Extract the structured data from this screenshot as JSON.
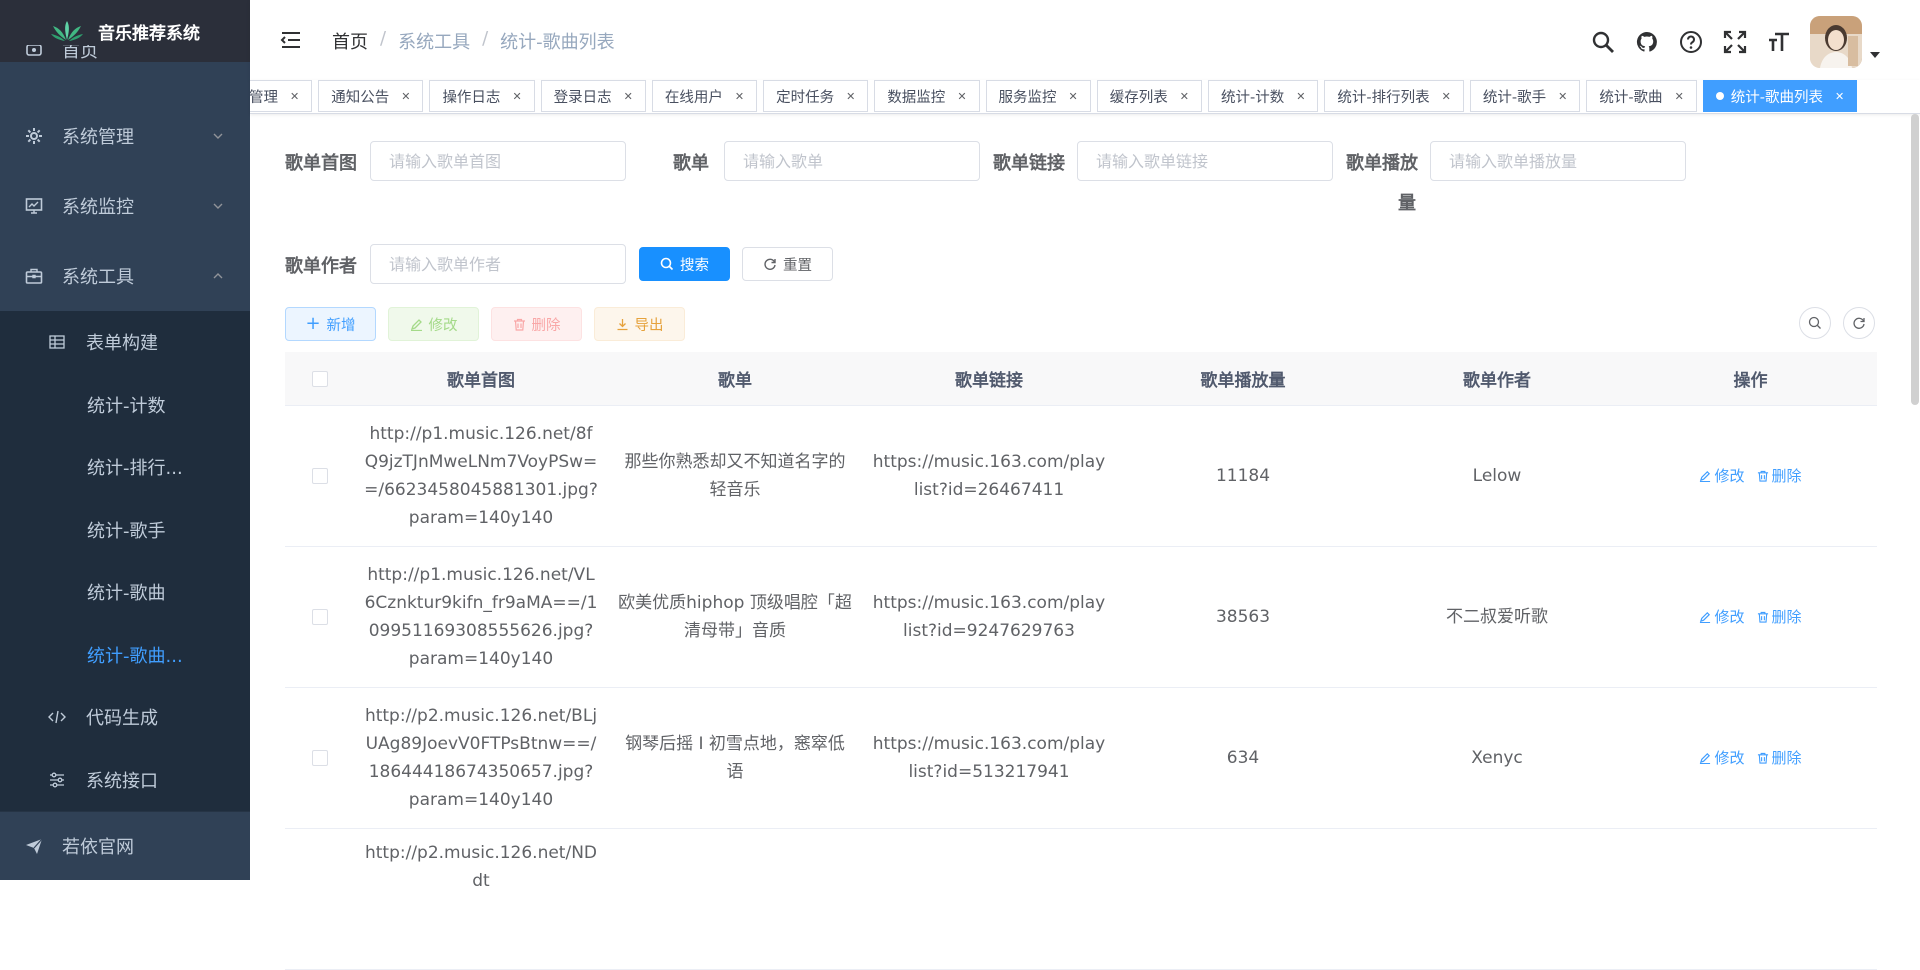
{
  "app": {
    "title": "音乐推荐系统"
  },
  "sidebar": {
    "top_partial": "首页",
    "menus": [
      {
        "label": "系统管理",
        "icon": "gear-icon"
      },
      {
        "label": "系统监控",
        "icon": "monitor-icon"
      },
      {
        "label": "系统工具",
        "icon": "toolbox-icon"
      }
    ],
    "submenu": [
      {
        "label": "表单构建",
        "icon": "grid-icon"
      },
      {
        "label": "统计-计数"
      },
      {
        "label": "统计-排行..."
      },
      {
        "label": "统计-歌手"
      },
      {
        "label": "统计-歌曲"
      },
      {
        "label": "统计-歌曲..."
      },
      {
        "label": "代码生成",
        "icon": "code-icon"
      },
      {
        "label": "系统接口",
        "icon": "sliders-icon"
      }
    ],
    "bottom": "若依官网"
  },
  "breadcrumb": {
    "home": "首页",
    "sep": "/",
    "level1": "系统工具",
    "level2": "统计-歌曲列表"
  },
  "tags": [
    {
      "label": "管理"
    },
    {
      "label": "通知公告"
    },
    {
      "label": "操作日志"
    },
    {
      "label": "登录日志"
    },
    {
      "label": "在线用户"
    },
    {
      "label": "定时任务"
    },
    {
      "label": "数据监控"
    },
    {
      "label": "服务监控"
    },
    {
      "label": "缓存列表"
    },
    {
      "label": "统计-计数"
    },
    {
      "label": "统计-排行列表"
    },
    {
      "label": "统计-歌手"
    },
    {
      "label": "统计-歌曲"
    },
    {
      "label": "统计-歌曲列表",
      "active": true
    }
  ],
  "search_form": {
    "cover_label": "歌单首图",
    "cover_placeholder": "请输入歌单首图",
    "name_label": "歌单",
    "name_placeholder": "请输入歌单",
    "link_label": "歌单链接",
    "link_placeholder": "请输入歌单链接",
    "play_label_1": "歌单播放",
    "play_label_2": "量",
    "play_placeholder": "请输入歌单播放量",
    "author_label": "歌单作者",
    "author_placeholder": "请输入歌单作者",
    "search_btn": "搜索",
    "reset_btn": "重置"
  },
  "toolbar": {
    "add": "新增",
    "edit": "修改",
    "delete": "删除",
    "export": "导出"
  },
  "table": {
    "headers": [
      "歌单首图",
      "歌单",
      "歌单链接",
      "歌单播放量",
      "歌单作者",
      "操作"
    ],
    "rows": [
      {
        "cover": "http://p1.music.126.net/8fQ9jzTJnMweLNm7VoyPSw==/6623458045881301.jpg?param=140y140",
        "name": "那些你熟悉却又不知道名字的轻音乐",
        "link": "https://music.163.com/playlist?id=26467411",
        "plays": "11184",
        "author": "Lelow"
      },
      {
        "cover": "http://p1.music.126.net/VL6Cznktur9kifn_fr9aMA==/109951169308555626.jpg?param=140y140",
        "name": "欧美优质hiphop 顶级唱腔「超清母带」音质",
        "link": "https://music.163.com/playlist?id=9247629763",
        "plays": "38563",
        "author": "不二叔爱听歌"
      },
      {
        "cover": "http://p2.music.126.net/BLjUAg89JoevV0FTPsBtnw==/18644418674350657.jpg?param=140y140",
        "name": "钢琴后摇 I 初雪点地，窸窣低语",
        "link": "https://music.163.com/playlist?id=513217941",
        "plays": "634",
        "author": "Xenyc"
      },
      {
        "cover": "http://p2.music.126.net/NDdt",
        "name": "",
        "link": "",
        "plays": "",
        "author": ""
      }
    ],
    "op_edit": "修改",
    "op_delete": "删除"
  },
  "colors": {
    "primary": "#409eff",
    "sidebar_bg": "#304156",
    "submenu_bg": "#1f2d3d"
  }
}
